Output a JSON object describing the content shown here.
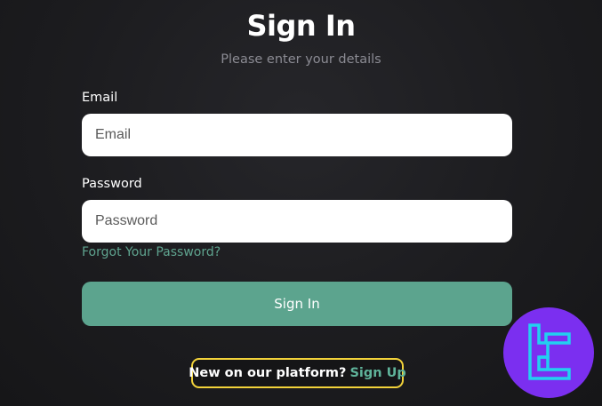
{
  "header": {
    "title": "Sign In",
    "subtitle": "Please enter your details"
  },
  "form": {
    "email_label": "Email",
    "email_placeholder": "Email",
    "email_value": "",
    "password_label": "Password",
    "password_placeholder": "Password",
    "password_value": "",
    "forgot_link": "Forgot Your Password?",
    "submit_label": "Sign In"
  },
  "footer": {
    "question": "New on our platform?",
    "signup_link": "Sign Up"
  },
  "logo": {
    "icon": "tc-brand-logo-icon"
  },
  "colors": {
    "accent": "#5ca48e",
    "link": "#5fa48f",
    "highlight_border": "#f2d23a",
    "logo_bg": "#7b2ff0",
    "logo_mark": "#22d0f0"
  }
}
